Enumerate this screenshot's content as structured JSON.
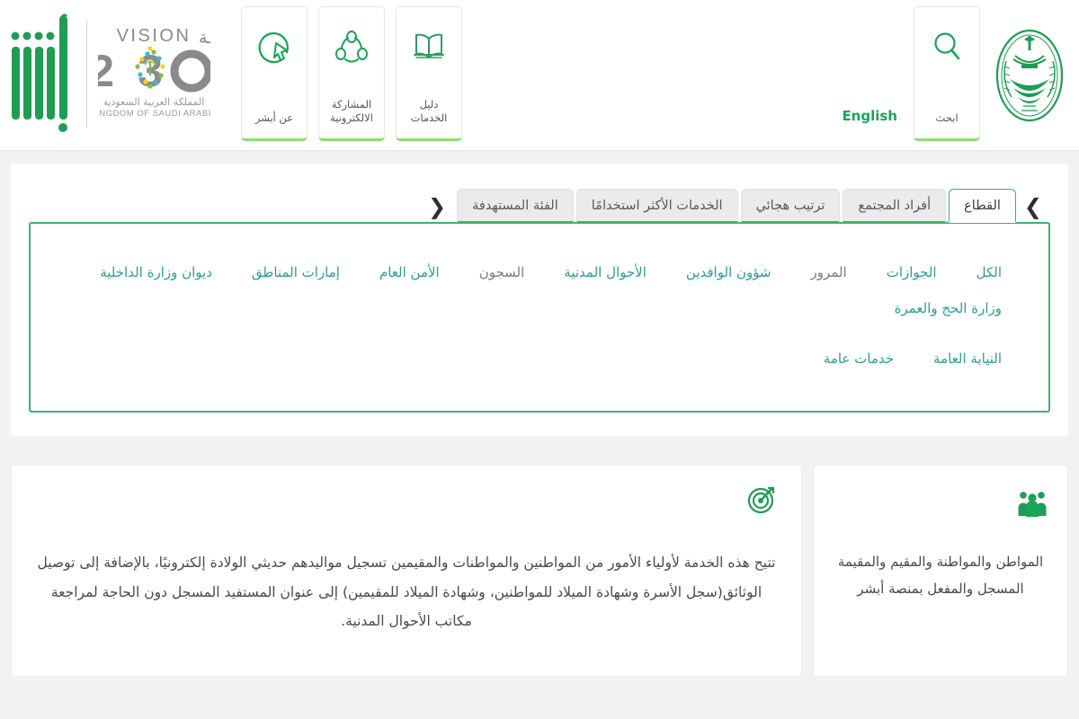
{
  "header": {
    "emblem_name": "saudi-ministry-of-interior-emblem",
    "search_tile": {
      "label": "ابحث",
      "icon": "search-icon"
    },
    "language_link": "English",
    "tiles": [
      {
        "label": "دليل الخدمات",
        "icon": "open-book-icon"
      },
      {
        "label": "المشاركة\nالالكترونية",
        "icon": "e-participation-people-network-icon"
      },
      {
        "label": "عن أبشر",
        "icon": "about-circle-cursor-icon"
      }
    ],
    "vision_logo": {
      "word_en": "VISION",
      "word_ar": "رؤيـــة",
      "year": "2030",
      "kingdom_ar": "المملكة العربية السعودية",
      "kingdom_en": "KINGDOM OF SAUDI ARABIA"
    },
    "absher_logo_alt": "أبشر"
  },
  "tabs": {
    "prev_arrow": "❮",
    "next_arrow": "❯",
    "items": [
      {
        "label": "القطاع",
        "active": true
      },
      {
        "label": "أفراد المجتمع",
        "active": false
      },
      {
        "label": "ترتيب هجائي",
        "active": false
      },
      {
        "label": "الخدمات الأكثر استخدامًا",
        "active": false
      },
      {
        "label": "الفئة المستهدفة",
        "active": false
      }
    ]
  },
  "filters": {
    "row1": [
      {
        "label": "الكل",
        "selected": true
      },
      {
        "label": "الجوازات",
        "selected": false
      },
      {
        "label": "المرور",
        "selected": false
      },
      {
        "label": "شؤون الوافدين",
        "selected": false
      },
      {
        "label": "الأحوال المدنية",
        "selected": false
      },
      {
        "label": "السجون",
        "selected": false
      },
      {
        "label": "الأمن العام",
        "selected": false
      },
      {
        "label": "إمارات المناطق",
        "selected": false
      },
      {
        "label": "ديوان وزارة الداخلية",
        "selected": false
      },
      {
        "label": "وزارة الحج والعمرة",
        "selected": false
      }
    ],
    "row2": [
      {
        "label": "النيابة العامة",
        "selected": false
      },
      {
        "label": "خدمات عامة",
        "selected": false
      }
    ]
  },
  "content": {
    "audience_card": {
      "icon": "group-of-people-icon",
      "text": "المواطن والمواطنة والمقيم والمقيمة المسجل والمفعل بمنصة أبشر"
    },
    "description_card": {
      "icon": "target-bullseye-icon",
      "text": "تتيح هذه الخدمة لأولياء الأمور من المواطنين والمواطنات والمقيمين تسجيل مواليدهم حديثي الولادة إلكترونيًا، بالإضافة إلى توصيل الوثائق(سجل الأسرة وشهادة الميلاد للمواطنين، وشهادة الميلاد للمقيمين) إلى عنوان المستفيد المسجل دون الحاجة لمراجعة مكاتب الأحوال المدنية."
    }
  },
  "colors": {
    "brand_green": "#18a558",
    "border_green": "#3cb371",
    "tab_underline_green": "#3cb371",
    "tile_underline_green": "#8ce06a",
    "chip_selected_teal": "#2e9e8f",
    "page_bg": "#f2f2f2"
  }
}
